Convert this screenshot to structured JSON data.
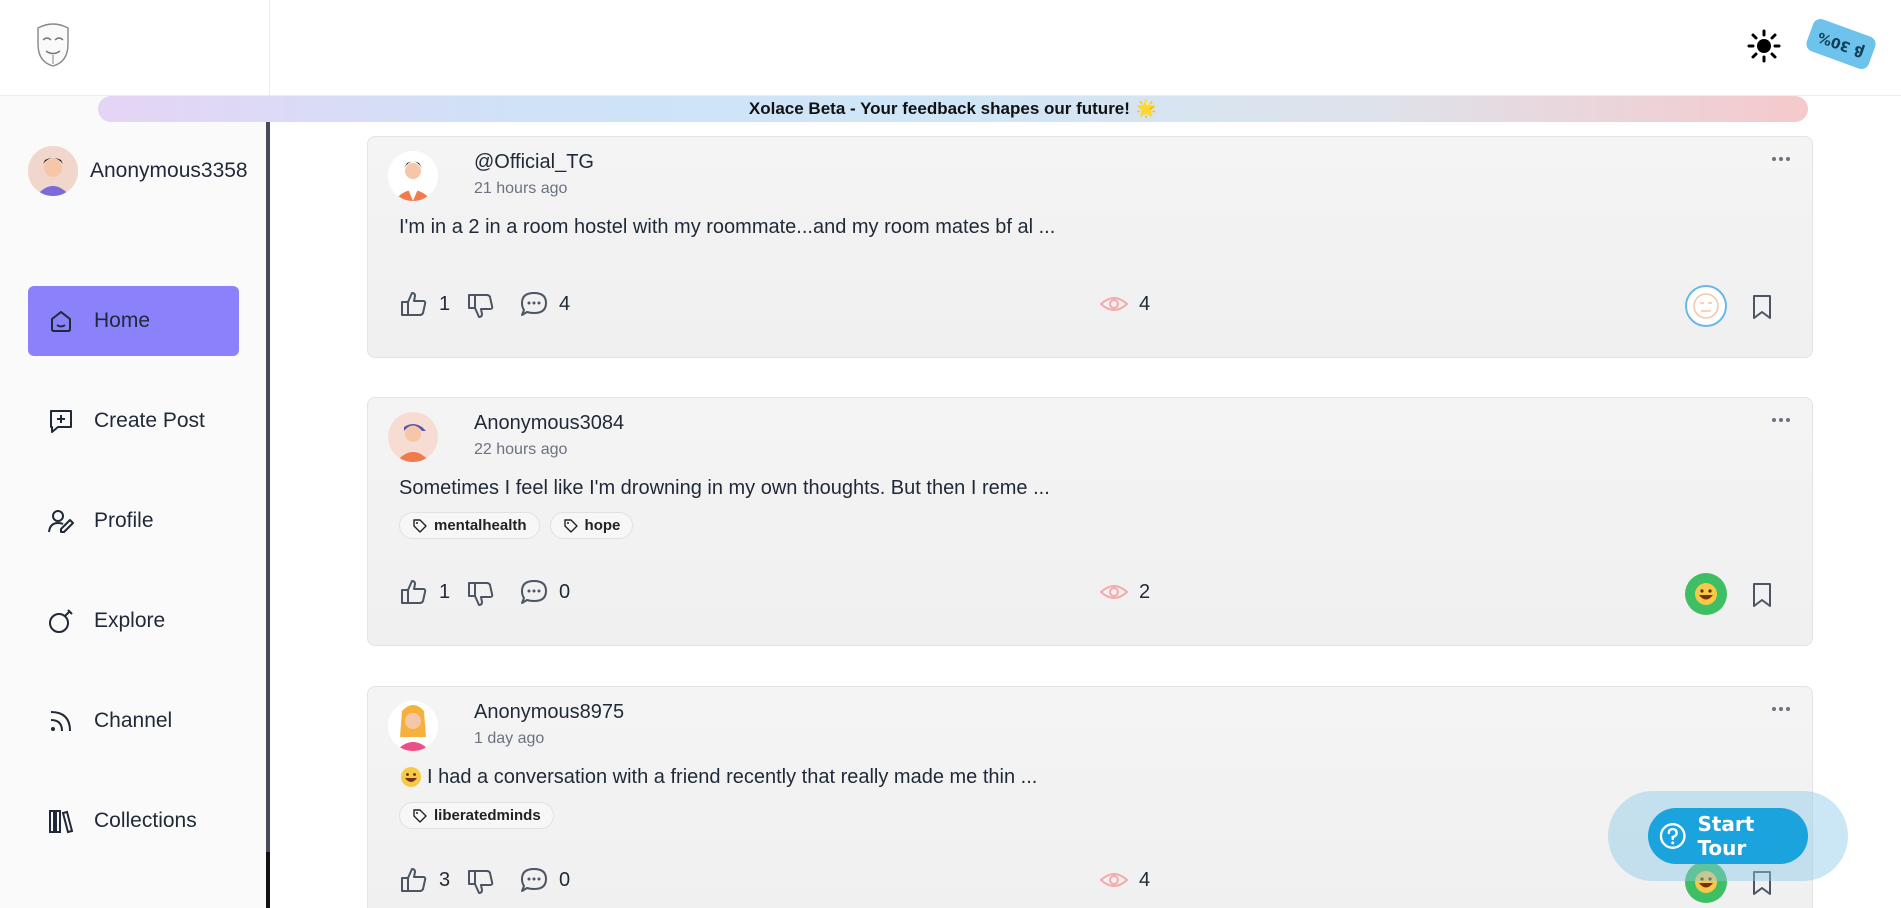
{
  "header": {
    "beta_badge": "β 30%"
  },
  "banner": {
    "text": "Xolace Beta - Your feedback shapes our future!",
    "emoji": "🌟"
  },
  "sidebar": {
    "username": "Anonymous3358",
    "items": [
      {
        "label": "Home",
        "icon": "home-icon",
        "active": true
      },
      {
        "label": "Create Post",
        "icon": "create-post-icon",
        "active": false
      },
      {
        "label": "Profile",
        "icon": "profile-icon",
        "active": false
      },
      {
        "label": "Explore",
        "icon": "explore-icon",
        "active": false
      },
      {
        "label": "Channel",
        "icon": "channel-icon",
        "active": false
      },
      {
        "label": "Collections",
        "icon": "collections-icon",
        "active": false
      }
    ]
  },
  "posts": [
    {
      "author": "@Official_TG",
      "time": "21 hours ago",
      "content": "I'm in a 2 in a room hostel with my roommate...and my room mates bf al ...",
      "tags": [],
      "likes": "1",
      "comments": "4",
      "views": "4",
      "mood": "neutral"
    },
    {
      "author": "Anonymous3084",
      "time": "22 hours ago",
      "content": "Sometimes I feel like I'm drowning in my own thoughts. But then I reme ...",
      "tags": [
        "mentalhealth",
        "hope"
      ],
      "likes": "1",
      "comments": "0",
      "views": "2",
      "mood": "happy"
    },
    {
      "author": "Anonymous8975",
      "time": "1 day ago",
      "content": "I had a conversation with a friend recently that really made me thin ...",
      "tags": [
        "liberatedminds"
      ],
      "likes": "3",
      "comments": "0",
      "views": "4",
      "mood": "happy"
    }
  ],
  "tour": {
    "label": "Start Tour"
  },
  "colors": {
    "accent": "#8b82fb",
    "tour": "#1aa3dd",
    "happy_mood": "#3fbf63"
  }
}
